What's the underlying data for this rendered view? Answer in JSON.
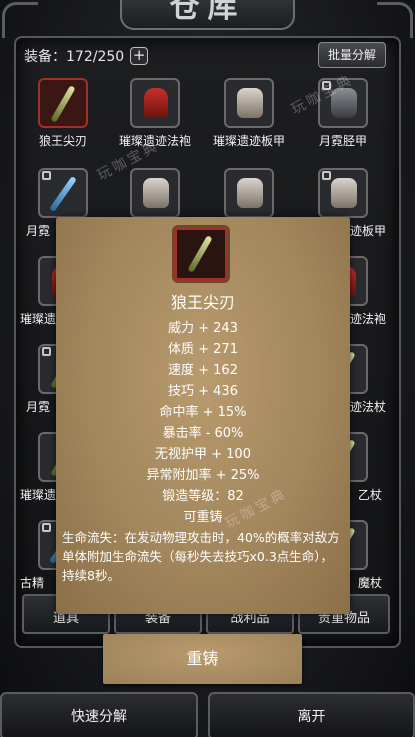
{
  "window": {
    "title": "仓库"
  },
  "header": {
    "equip_label": "装备：172/250",
    "plus_label": "+",
    "bulk_label": "批量分解"
  },
  "grid": {
    "row1": [
      "狼王尖刃",
      "璀璨遗迹法袍",
      "璀璨遗迹板甲",
      "月霓胫甲"
    ],
    "row2": [
      "月霓",
      "",
      "",
      "迹板甲"
    ],
    "row3": [
      "璀璨遗",
      "",
      "",
      "迹法袍"
    ],
    "row4": [
      "月霓",
      "",
      "",
      "迹法杖"
    ],
    "row5": [
      "璀璨遗",
      "",
      "",
      "乙杖"
    ],
    "row6": [
      "古精",
      "",
      "",
      "魔杖"
    ]
  },
  "watermarks": [
    "玩咖宝典",
    "玩咖宝典",
    "玩咖宝典"
  ],
  "popup": {
    "name": "狼王尖刃",
    "stats": [
      "威力 + 243",
      "体质 + 271",
      "速度 + 162",
      "技巧 + 436",
      "命中率 + 15%",
      "暴击率 - 60%",
      "无视护甲 + 100",
      "异常附加率 + 25%",
      "锻造等级：82",
      "可重铸"
    ],
    "description": "生命流失：在发动物理攻击时，40%的概率对敌方单体附加生命流失（每秒失去技巧x0.3点生命），持续8秒。"
  },
  "tabs": [
    "道具",
    "装备",
    "战利品",
    "贵重物品"
  ],
  "actions": {
    "reforge": "重铸",
    "quick_decompose": "快速分解",
    "leave": "离开"
  }
}
